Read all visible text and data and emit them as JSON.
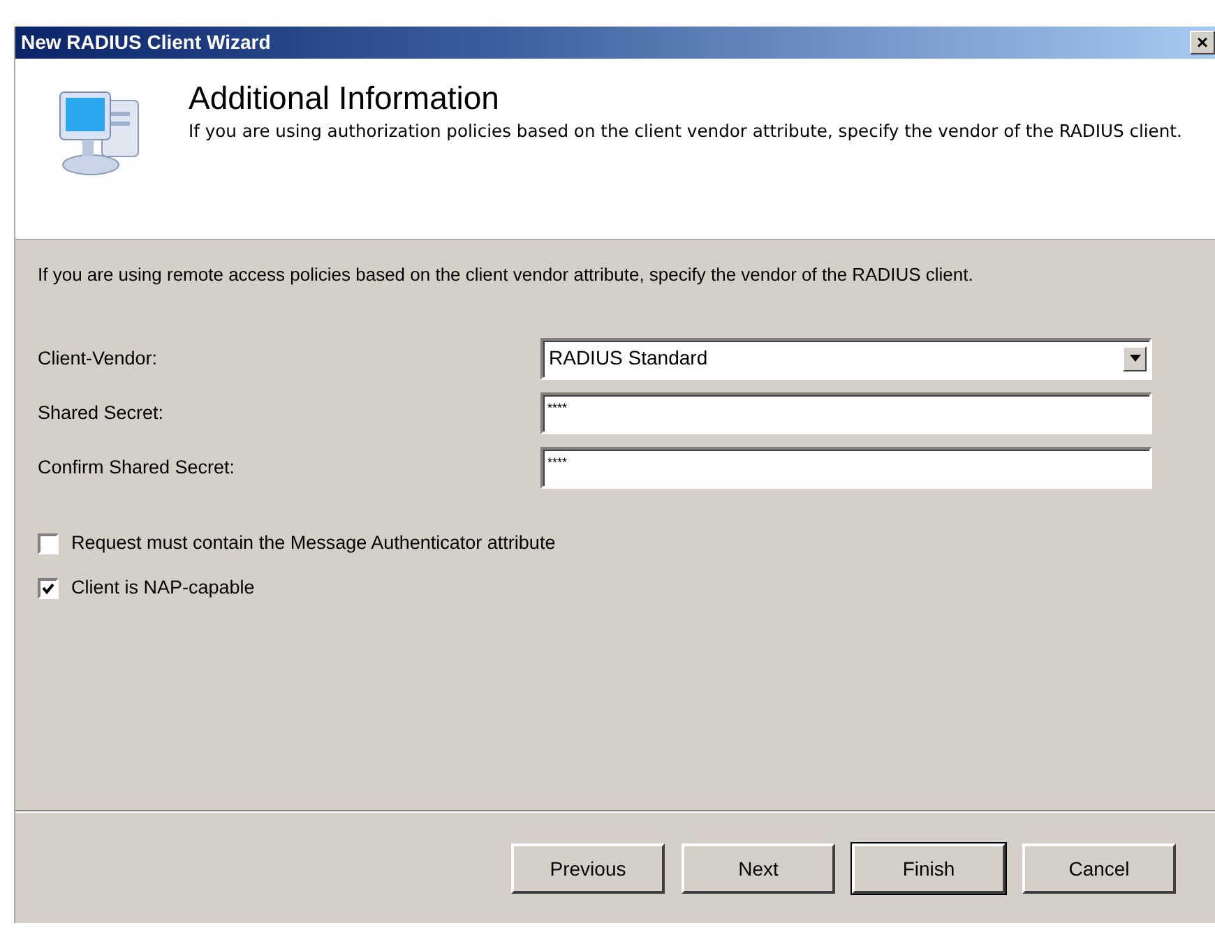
{
  "window": {
    "title": "New RADIUS Client Wizard",
    "close": "×"
  },
  "header": {
    "title": "Additional Information",
    "description": "If you are using authorization policies based on the client vendor attribute, specify the vendor of the RADIUS client."
  },
  "intro": "If you are using remote access policies based on the client vendor attribute, specify the vendor of the RADIUS client.",
  "fields": [
    {
      "kind": "dropdown",
      "label": "Client-Vendor:",
      "value": "RADIUS Standard"
    },
    {
      "kind": "password",
      "label": "Shared Secret:",
      "value": "****"
    },
    {
      "kind": "password",
      "label": "Confirm Shared Secret:",
      "value": "****"
    }
  ],
  "checkboxes": [
    {
      "label": "Request must contain the Message Authenticator attribute",
      "checked": false
    },
    {
      "label": "Client is NAP-capable",
      "checked": true
    }
  ],
  "buttons": [
    {
      "label": "Previous",
      "default": false
    },
    {
      "label": "Next",
      "default": false
    },
    {
      "label": "Finish",
      "default": true
    },
    {
      "label": "Cancel",
      "default": false
    }
  ]
}
